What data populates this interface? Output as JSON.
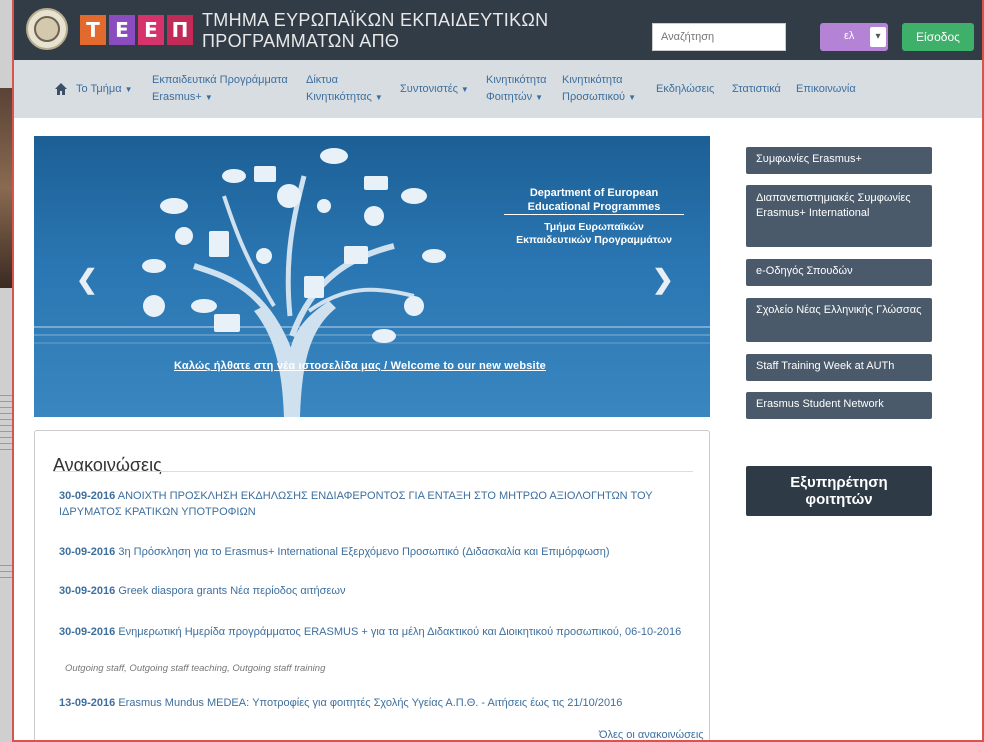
{
  "header": {
    "logo_letters": [
      "Τ",
      "Ε",
      "Ε",
      "Π"
    ],
    "title_line1": "ΤΜΗΜΑ ΕΥΡΩΠΑΪΚΩΝ ΕΚΠΑΙΔΕΥΤΙΚΩΝ",
    "title_line2": "ΠΡΟΓΡΑΜΜΑΤΩΝ ΑΠΘ",
    "search_placeholder": "Αναζήτηση",
    "lang_value": "ελ",
    "login_label": "Είσοδος"
  },
  "nav": {
    "items": [
      {
        "label_1": "Το Τμήμα",
        "label_2": ""
      },
      {
        "label_1": "Εκπαιδευτικά Προγράμματα",
        "label_2": "Erasmus+"
      },
      {
        "label_1": "Δίκτυα",
        "label_2": "Κινητικότητας"
      },
      {
        "label_1": "Συντονιστές",
        "label_2": ""
      },
      {
        "label_1": "Κινητικότητα",
        "label_2": "Φοιτητών"
      },
      {
        "label_1": "Κινητικότητα",
        "label_2": "Προσωπικού"
      },
      {
        "label_1": "Εκδηλώσεις",
        "label_2": ""
      },
      {
        "label_1": "Στατιστικά",
        "label_2": ""
      },
      {
        "label_1": "Επικοινωνία",
        "label_2": ""
      }
    ]
  },
  "slider": {
    "en_line1": "Department of European",
    "en_line2": "Educational Programmes",
    "gr_line1": "Τμήμα Ευρωπαϊκών",
    "gr_line2": "Εκπαιδευτικών Προγραμμάτων",
    "caption": "Καλώς ήλθατε στη νέα ιστοσελίδα μας / Welcome to our new website"
  },
  "sidebar": {
    "links": [
      "Συμφωνίες Erasmus+",
      "Διαπανεπιστημιακές Συμφωνίες Erasmus+ International",
      "e-Οδηγός Σπουδών",
      "Σχολείο Νέας Ελληνικής Γλώσσας",
      "Staff Training Week at AUTh",
      "Erasmus Student Network"
    ],
    "service_line1": "Εξυπηρέτηση",
    "service_line2": "φοιτητών"
  },
  "announcements": {
    "heading": "Ανακοινώσεις",
    "items": [
      {
        "date": "30-09-2016",
        "text": "ΑΝΟΙΧΤΗ ΠΡΟΣΚΛΗΣΗ ΕΚΔΗΛΩΣΗΣ ΕΝΔΙΑΦΕΡΟΝΤΟΣ ΓΙΑ ΕΝΤΑΞΗ ΣΤΟ ΜΗΤΡΩΟ ΑΞΙΟΛΟΓΗΤΩΝ ΤΟΥ ΙΔΡΥΜΑΤΟΣ ΚΡΑΤΙΚΩΝ ΥΠΟΤΡΟΦΙΩΝ"
      },
      {
        "date": "30-09-2016",
        "text": "3η Πρόσκληση για το Erasmus+ International Εξερχόμενο Προσωπικό (Διδασκαλία και Επιμόρφωση)"
      },
      {
        "date": "30-09-2016",
        "text": "Greek diaspora grants Νέα περίοδος αιτήσεων"
      },
      {
        "date": "30-09-2016",
        "text": "Ενημερωτική Ημερίδα προγράμματος ERASMUS + για τα μέλη Διδακτικού και Διοικητικού προσωπικού, 06-10-2016",
        "tags": "Outgoing staff, Outgoing staff teaching, Outgoing staff training"
      },
      {
        "date": "13-09-2016",
        "text": "Erasmus Mundus MEDEA: Υποτροφίες για φοιτητές Σχολής Υγείας Α.Π.Θ. - Αιτήσεις έως τις 21/10/2016"
      }
    ],
    "all_link": "Όλες οι ανακοινώσεις"
  }
}
